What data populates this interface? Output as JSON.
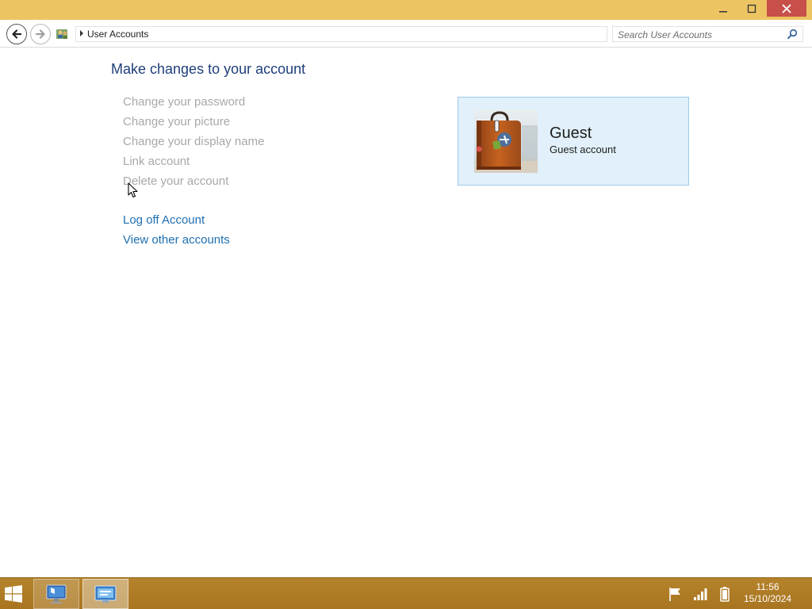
{
  "window": {
    "minimize_icon": "minimize-icon",
    "maximize_icon": "maximize-icon",
    "close_icon": "close-icon",
    "close_color": "#c7504a",
    "titlebar_color": "#ecc462"
  },
  "address_bar": {
    "breadcrumb": "User Accounts",
    "search_placeholder": "Search User Accounts"
  },
  "main": {
    "title": "Make changes to your account",
    "tasks": [
      {
        "label": "Change your password",
        "enabled": false
      },
      {
        "label": "Change your picture",
        "enabled": false
      },
      {
        "label": "Change your display name",
        "enabled": false
      },
      {
        "label": "Link account",
        "enabled": false
      },
      {
        "label": "Delete your account",
        "enabled": false
      }
    ],
    "links": [
      {
        "label": "Log off Account"
      },
      {
        "label": "View other accounts"
      }
    ]
  },
  "account": {
    "name": "Guest",
    "type": "Guest account",
    "picture_icon": "suitcase-icon"
  },
  "taskbar": {
    "time": "11:56",
    "date": "15/10/2024",
    "color": "#b07c25"
  }
}
